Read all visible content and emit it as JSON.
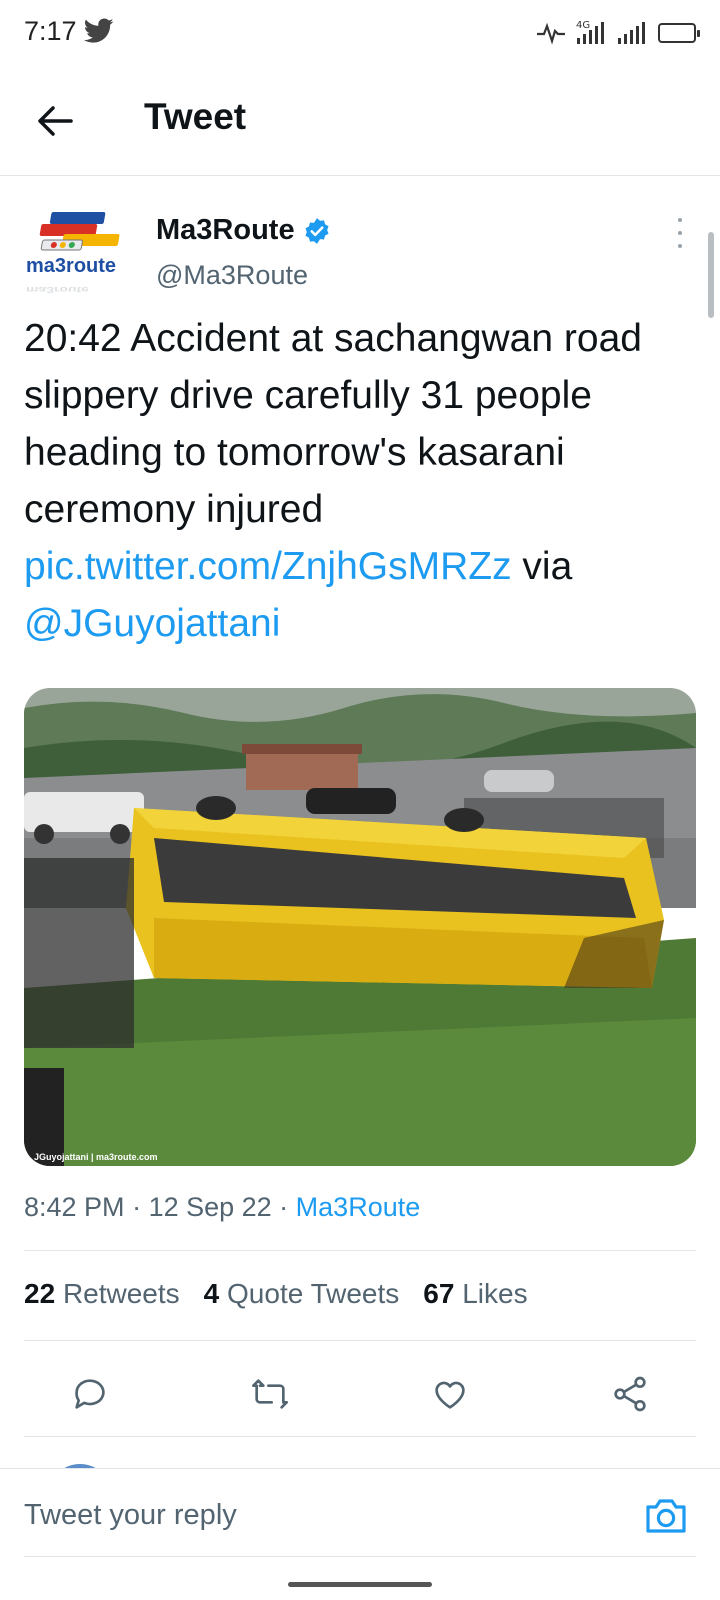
{
  "status_bar": {
    "time": "7:17",
    "network": "4G",
    "icons": [
      "twitter-bird-icon",
      "activity-icon",
      "signal-icon",
      "battery-icon"
    ]
  },
  "header": {
    "title": "Tweet",
    "back_icon": "arrow-left-icon"
  },
  "tweet": {
    "author_name": "Ma3Route",
    "author_handle": "@Ma3Route",
    "verified": true,
    "avatar_text": "ma3route",
    "text_main": "20:42 Accident at sachangwan road slippery drive carefully 31 people heading to tomorrow's kasarani ceremony injured ",
    "link_pic": "pic.twitter.com/ZnjhGsMRZz",
    "text_via": " via ",
    "link_mention": "@JGuyojattani",
    "media_watermark": "JGuyojattani | ma3route.com",
    "time": "8:42 PM",
    "date": "12 Sep 22",
    "source": "Ma3Route",
    "separator": " · "
  },
  "stats": {
    "retweets_count": "22",
    "retweets_label": "Retweets",
    "quotes_count": "4",
    "quotes_label": "Quote Tweets",
    "likes_count": "67",
    "likes_label": "Likes"
  },
  "actions": [
    "reply-icon",
    "retweet-icon",
    "like-icon",
    "share-icon"
  ],
  "reply": {
    "placeholder": "Tweet your reply"
  },
  "colors": {
    "link": "#1d9bf0",
    "text": "#0f1419",
    "secondary": "#536471",
    "divider": "#e3e6e8"
  }
}
